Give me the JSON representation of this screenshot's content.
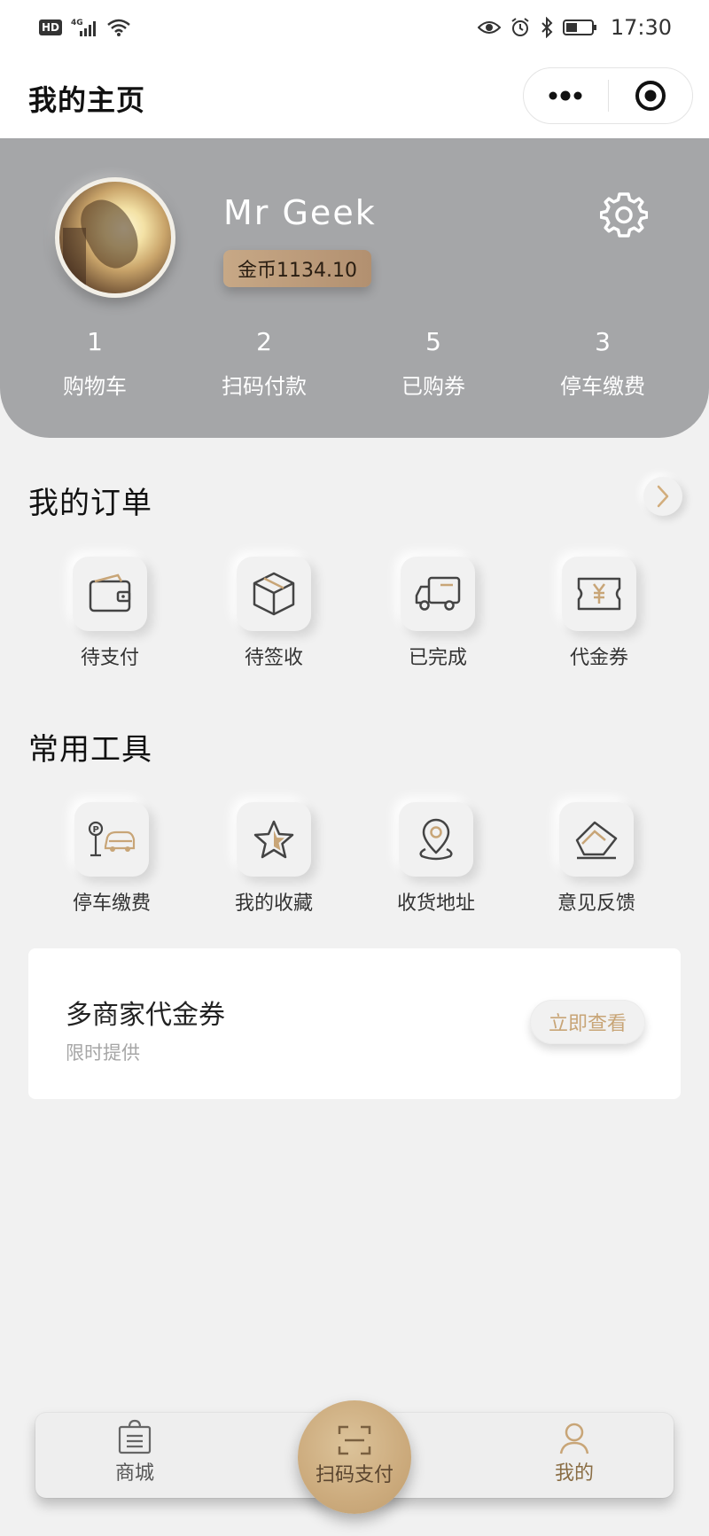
{
  "status_bar": {
    "network_badge": "HD",
    "network_type": "4G",
    "time": "17:30"
  },
  "header": {
    "title": "我的主页",
    "icons": [
      "more-icon",
      "target-icon"
    ]
  },
  "profile": {
    "username": "Mr Geek",
    "coins_label": "金币1134.10",
    "stats": [
      {
        "count": "1",
        "label": "购物车"
      },
      {
        "count": "2",
        "label": "扫码付款"
      },
      {
        "count": "5",
        "label": "已购券"
      },
      {
        "count": "3",
        "label": "停车缴费"
      }
    ]
  },
  "orders": {
    "title": "我的订单",
    "items": [
      {
        "label": "待支付",
        "icon": "wallet-icon"
      },
      {
        "label": "待签收",
        "icon": "package-icon"
      },
      {
        "label": "已完成",
        "icon": "truck-icon"
      },
      {
        "label": "代金券",
        "icon": "voucher-icon"
      }
    ]
  },
  "tools": {
    "title": "常用工具",
    "items": [
      {
        "label": "停车缴费",
        "icon": "parking-icon"
      },
      {
        "label": "我的收藏",
        "icon": "star-icon"
      },
      {
        "label": "收货地址",
        "icon": "location-icon"
      },
      {
        "label": "意见反馈",
        "icon": "feedback-icon"
      }
    ]
  },
  "promo": {
    "title": "多商家代金券",
    "subtitle": "限时提供",
    "button_label": "立即查看"
  },
  "tabbar": {
    "tabs": [
      {
        "label": "商城",
        "icon": "shop-bag-icon"
      },
      {
        "label": "扫码支付",
        "icon": "scan-icon"
      },
      {
        "label": "我的",
        "icon": "user-icon"
      }
    ],
    "active_tab": "我的"
  },
  "colors": {
    "header_bg": "#a5a6a8",
    "accent_gold": "#c8a577",
    "page_bg": "#f1f1f1"
  }
}
